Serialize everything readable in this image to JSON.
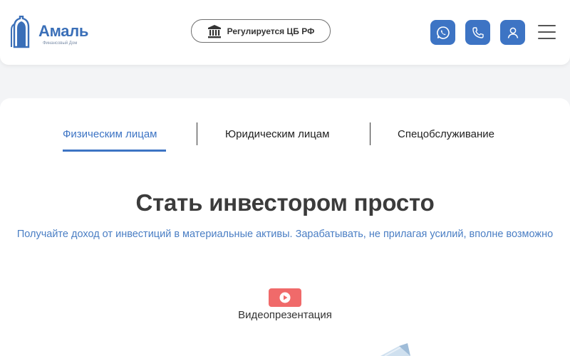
{
  "brand": {
    "name": "Амаль",
    "subtitle": "Финансовый Дом",
    "color": "#3a6fb8"
  },
  "header": {
    "regulated_label": "Регулируется ЦБ РФ",
    "buttons": [
      {
        "icon": "whatsapp-icon"
      },
      {
        "icon": "phone-icon"
      },
      {
        "icon": "user-icon"
      }
    ],
    "menu_icon": "hamburger-menu-icon",
    "accent": "#3d74c4"
  },
  "tabs": [
    {
      "label": "Физическим лицам",
      "active": true
    },
    {
      "label": "Юридическим лицам",
      "active": false
    },
    {
      "label": "Спецобслуживание",
      "active": false
    }
  ],
  "hero": {
    "title": "Стать инвестором просто",
    "subtitle": "Получайте доход от инвестиций в материальные активы. Зарабатывать, не прилагая усилий, вполне возможно"
  },
  "video": {
    "label": "Видеопрезентация",
    "icon": "play-icon",
    "color": "#f06a6a"
  }
}
